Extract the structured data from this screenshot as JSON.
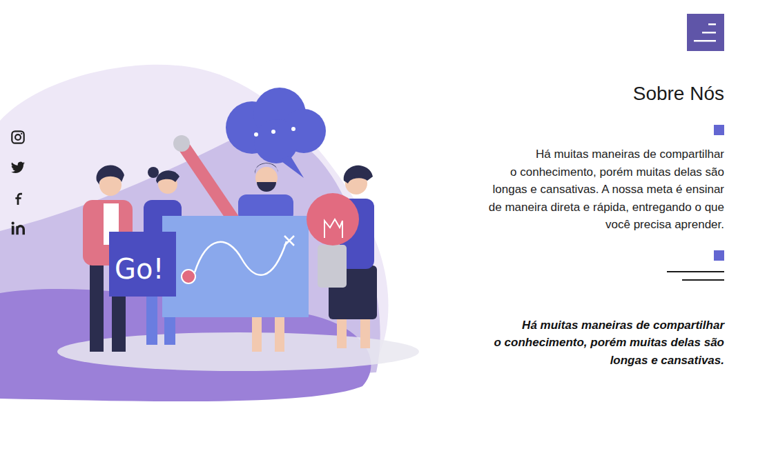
{
  "page": {
    "title": "Sobre Nós"
  },
  "about": {
    "lines": [
      "Há muitas maneiras de compartilhar",
      "o conhecimento, porém muitas delas são",
      "longas e cansativas. A nossa meta é ensinar",
      "de maneira direta e rápida, entregando o que",
      "você precisa aprender."
    ]
  },
  "quote": {
    "lines": [
      "Há muitas maneiras de compartilhar",
      "o conhecimento, porém muitas delas são",
      "longas e cansativas."
    ]
  },
  "illustration": {
    "sign": "Go!"
  }
}
